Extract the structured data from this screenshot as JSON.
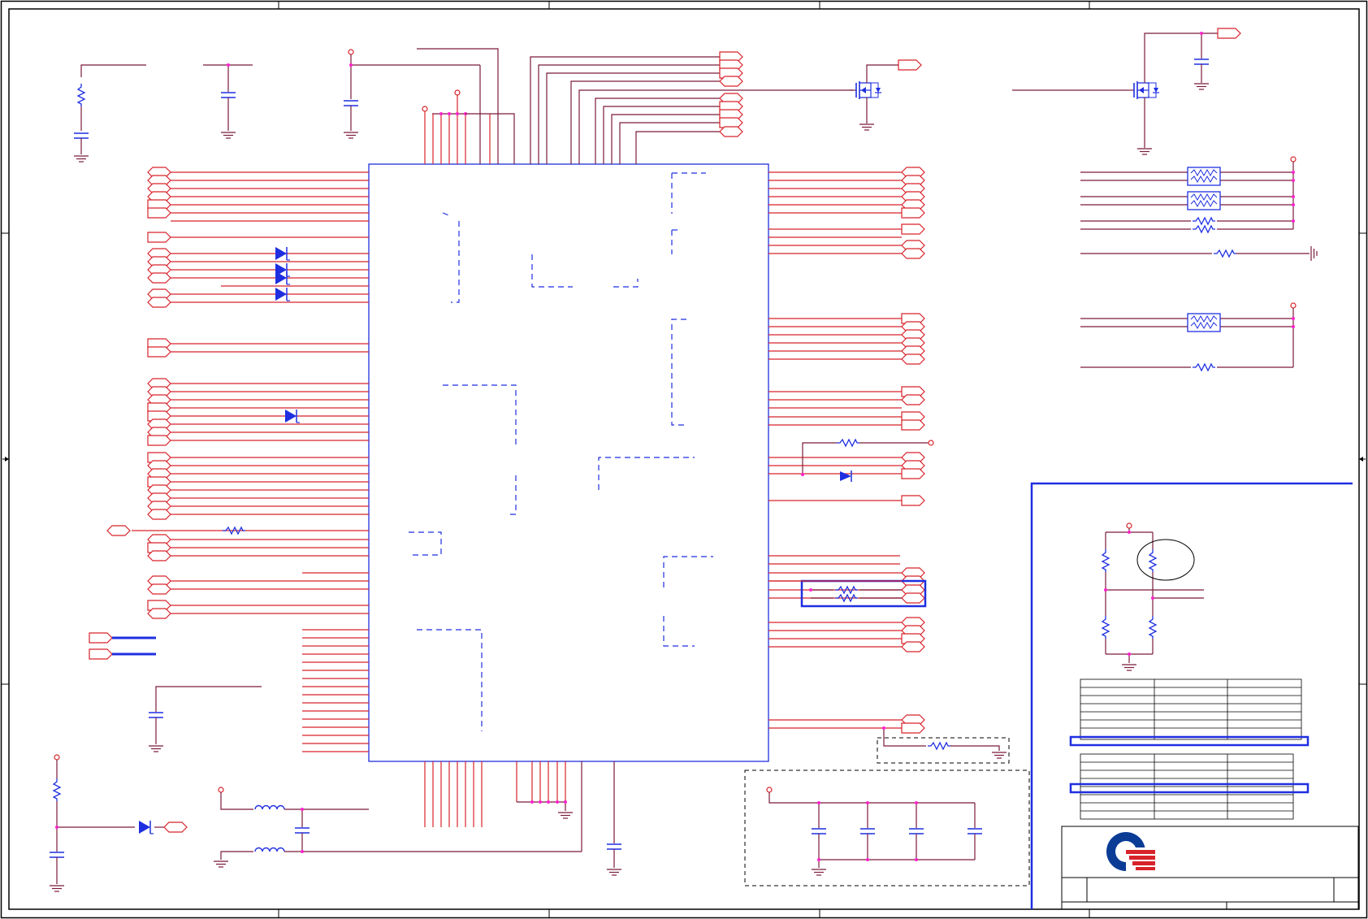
{
  "sheet": {
    "background": "#ffffff",
    "colors": {
      "wire": "#d8232a",
      "signal_wire": "#7a1b3a",
      "component_body": "#1f2fe0",
      "junction": "#ff22cc",
      "frame": "#000000",
      "logo_blue": "#0a3c96",
      "logo_red": "#d8232a"
    }
  },
  "icons": {
    "ic": "ic-symbol",
    "mosfet": "mosfet-icon",
    "resistor": "resistor-icon",
    "capacitor": "capacitor-icon",
    "inductor": "inductor-icon",
    "diode": "diode-icon",
    "ground": "ground-icon",
    "power": "power-flag-icon",
    "port": "net-port-icon",
    "logo": "company-logo"
  }
}
